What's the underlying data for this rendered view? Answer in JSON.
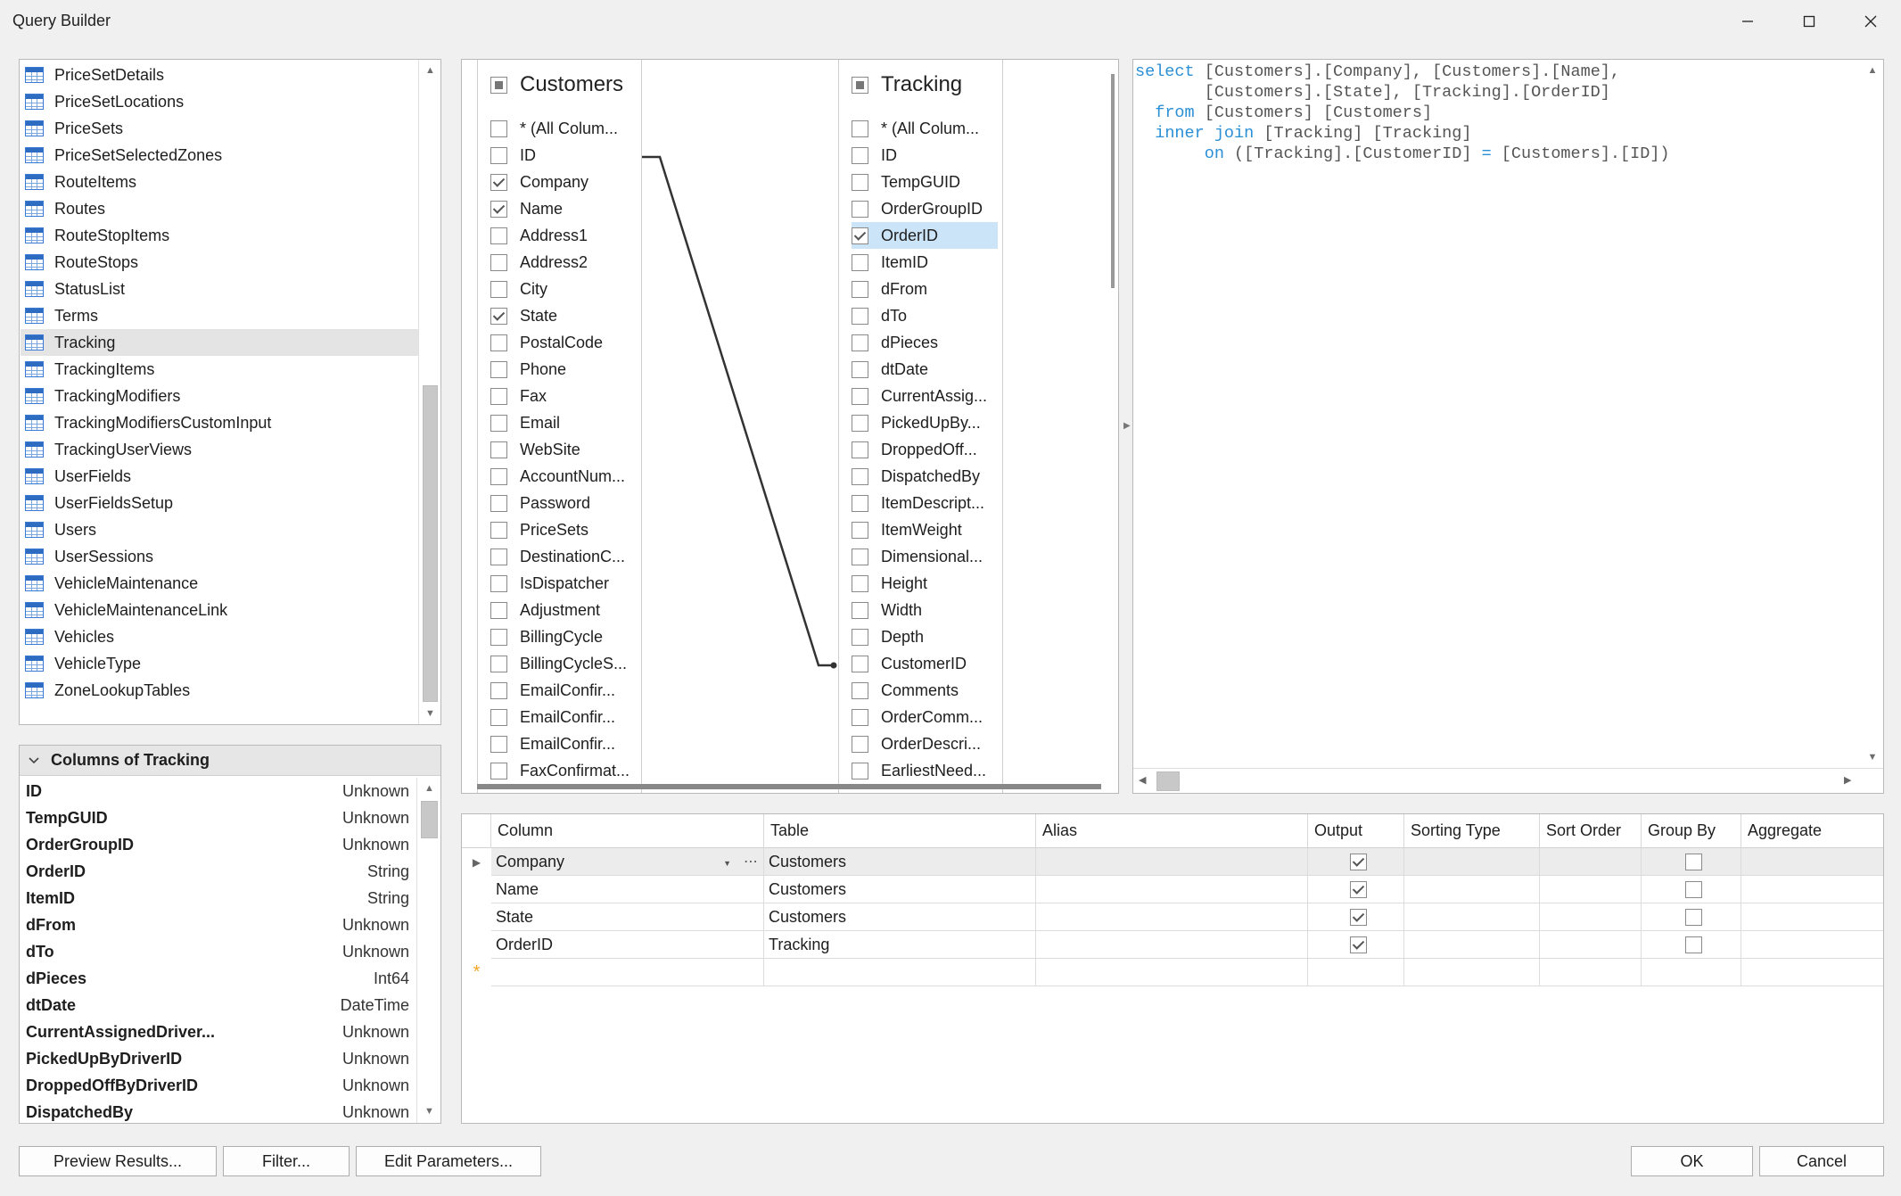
{
  "window": {
    "title": "Query Builder"
  },
  "tables": [
    "PriceSetDetails",
    "PriceSetLocations",
    "PriceSets",
    "PriceSetSelectedZones",
    "RouteItems",
    "Routes",
    "RouteStopItems",
    "RouteStops",
    "StatusList",
    "Terms",
    "Tracking",
    "TrackingItems",
    "TrackingModifiers",
    "TrackingModifiersCustomInput",
    "TrackingUserViews",
    "UserFields",
    "UserFieldsSetup",
    "Users",
    "UserSessions",
    "VehicleMaintenance",
    "VehicleMaintenanceLink",
    "Vehicles",
    "VehicleType",
    "ZoneLookupTables"
  ],
  "selected_table": "Tracking",
  "columns_panel": {
    "title": "Columns of Tracking",
    "rows": [
      {
        "name": "ID",
        "type": "Unknown"
      },
      {
        "name": "TempGUID",
        "type": "Unknown"
      },
      {
        "name": "OrderGroupID",
        "type": "Unknown"
      },
      {
        "name": "OrderID",
        "type": "String"
      },
      {
        "name": "ItemID",
        "type": "String"
      },
      {
        "name": "dFrom",
        "type": "Unknown"
      },
      {
        "name": "dTo",
        "type": "Unknown"
      },
      {
        "name": "dPieces",
        "type": "Int64"
      },
      {
        "name": "dtDate",
        "type": "DateTime"
      },
      {
        "name": "CurrentAssignedDriver...",
        "type": "Unknown"
      },
      {
        "name": "PickedUpByDriverID",
        "type": "Unknown"
      },
      {
        "name": "DroppedOffByDriverID",
        "type": "Unknown"
      },
      {
        "name": "DispatchedBy",
        "type": "Unknown"
      }
    ]
  },
  "diagram": {
    "customers": {
      "title": "Customers",
      "columns": [
        {
          "label": "* (All Colum...",
          "checked": false
        },
        {
          "label": "ID",
          "checked": false
        },
        {
          "label": "Company",
          "checked": true
        },
        {
          "label": "Name",
          "checked": true
        },
        {
          "label": "Address1",
          "checked": false
        },
        {
          "label": "Address2",
          "checked": false
        },
        {
          "label": "City",
          "checked": false
        },
        {
          "label": "State",
          "checked": true
        },
        {
          "label": "PostalCode",
          "checked": false
        },
        {
          "label": "Phone",
          "checked": false
        },
        {
          "label": "Fax",
          "checked": false
        },
        {
          "label": "Email",
          "checked": false
        },
        {
          "label": "WebSite",
          "checked": false
        },
        {
          "label": "AccountNum...",
          "checked": false
        },
        {
          "label": "Password",
          "checked": false
        },
        {
          "label": "PriceSets",
          "checked": false
        },
        {
          "label": "DestinationC...",
          "checked": false
        },
        {
          "label": "IsDispatcher",
          "checked": false
        },
        {
          "label": "Adjustment",
          "checked": false
        },
        {
          "label": "BillingCycle",
          "checked": false
        },
        {
          "label": "BillingCycleS...",
          "checked": false
        },
        {
          "label": "EmailConfir...",
          "checked": false
        },
        {
          "label": "EmailConfir...",
          "checked": false
        },
        {
          "label": "EmailConfir...",
          "checked": false
        },
        {
          "label": "FaxConfirmat...",
          "checked": false
        }
      ]
    },
    "tracking": {
      "title": "Tracking",
      "columns": [
        {
          "label": "* (All Colum...",
          "checked": false
        },
        {
          "label": "ID",
          "checked": false
        },
        {
          "label": "TempGUID",
          "checked": false
        },
        {
          "label": "OrderGroupID",
          "checked": false
        },
        {
          "label": "OrderID",
          "checked": true
        },
        {
          "label": "ItemID",
          "checked": false
        },
        {
          "label": "dFrom",
          "checked": false
        },
        {
          "label": "dTo",
          "checked": false
        },
        {
          "label": "dPieces",
          "checked": false
        },
        {
          "label": "dtDate",
          "checked": false
        },
        {
          "label": "CurrentAssig...",
          "checked": false
        },
        {
          "label": "PickedUpBy...",
          "checked": false
        },
        {
          "label": "DroppedOff...",
          "checked": false
        },
        {
          "label": "DispatchedBy",
          "checked": false
        },
        {
          "label": "ItemDescript...",
          "checked": false
        },
        {
          "label": "ItemWeight",
          "checked": false
        },
        {
          "label": "Dimensional...",
          "checked": false
        },
        {
          "label": "Height",
          "checked": false
        },
        {
          "label": "Width",
          "checked": false
        },
        {
          "label": "Depth",
          "checked": false
        },
        {
          "label": "CustomerID",
          "checked": false
        },
        {
          "label": "Comments",
          "checked": false
        },
        {
          "label": "OrderComm...",
          "checked": false
        },
        {
          "label": "OrderDescri...",
          "checked": false
        },
        {
          "label": "EarliestNeed...",
          "checked": false
        }
      ]
    }
  },
  "sql": {
    "lines": [
      [
        {
          "t": "select",
          "k": true
        },
        {
          "t": " [Customers].[Company], [Customers].[Name],"
        }
      ],
      [
        {
          "t": "       [Customers].[State], [Tracking].[OrderID]"
        }
      ],
      [
        {
          "t": "  "
        },
        {
          "t": "from",
          "k": true
        },
        {
          "t": " [Customers] [Customers]"
        }
      ],
      [
        {
          "t": "  "
        },
        {
          "t": "inner join",
          "k": true
        },
        {
          "t": " [Tracking] [Tracking]"
        }
      ],
      [
        {
          "t": "       "
        },
        {
          "t": "on",
          "k": true
        },
        {
          "t": " ([Tracking].[CustomerID] "
        },
        {
          "t": "=",
          "k": true
        },
        {
          "t": " [Customers].[ID])"
        }
      ]
    ]
  },
  "grid": {
    "headers": [
      "Column",
      "Table",
      "Alias",
      "Output",
      "Sorting Type",
      "Sort Order",
      "Group By",
      "Aggregate"
    ],
    "rows": [
      {
        "column": "Company",
        "table": "Customers",
        "output": true,
        "group_by": false
      },
      {
        "column": "Name",
        "table": "Customers",
        "output": true,
        "group_by": false
      },
      {
        "column": "State",
        "table": "Customers",
        "output": true,
        "group_by": false
      },
      {
        "column": "OrderID",
        "table": "Tracking",
        "output": true,
        "group_by": false
      }
    ],
    "new_row_marker": "*"
  },
  "buttons": {
    "preview": "Preview Results...",
    "filter": "Filter...",
    "edit_params": "Edit Parameters...",
    "ok": "OK",
    "cancel": "Cancel"
  },
  "colors": {
    "accent": "#2b8fd6",
    "selection": "#cce4f7",
    "row_selected": "#e4e4e4",
    "new_row_marker": "#f5a623"
  }
}
